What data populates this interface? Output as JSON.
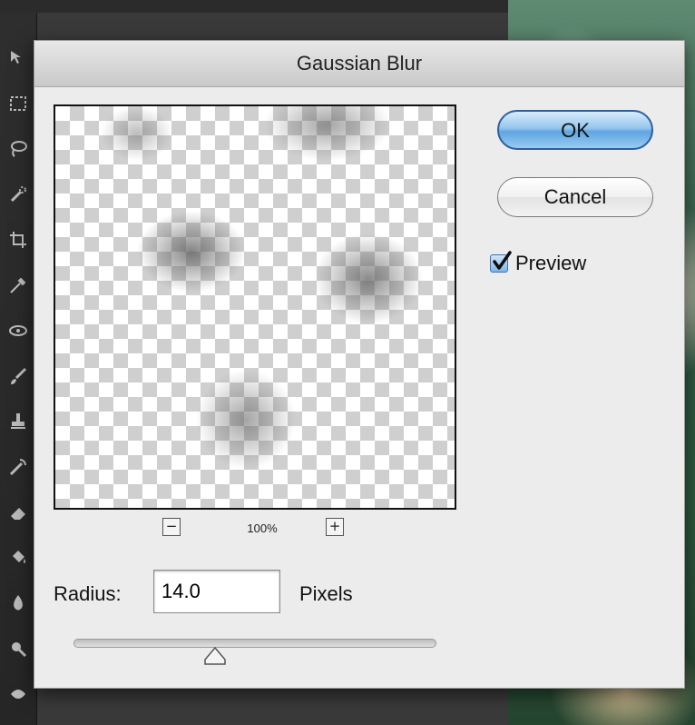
{
  "dialog": {
    "title": "Gaussian Blur",
    "ok_label": "OK",
    "cancel_label": "Cancel",
    "preview_label": "Preview",
    "preview_checked": true
  },
  "zoom": {
    "level": "100%",
    "minus_icon": "zoom-out-icon",
    "plus_icon": "zoom-in-icon",
    "minus_glyph": "−",
    "plus_glyph": "+"
  },
  "radius": {
    "label": "Radius:",
    "value": "14.0",
    "units": "Pixels",
    "slider_fraction": 0.39
  },
  "toolbox": {
    "icons": [
      "move-icon",
      "marquee-icon",
      "lasso-icon",
      "quick-selection-icon",
      "crop-icon",
      "eyedropper-icon",
      "spot-healing-icon",
      "brush-icon",
      "clone-stamp-icon",
      "history-brush-icon",
      "eraser-icon",
      "paint-bucket-icon",
      "blur-tool-icon",
      "dodge-icon"
    ]
  },
  "colors": {
    "ok_button_blue": "#5fa6e2",
    "dialog_bg": "#ececec",
    "checkbox_blue": "#3d6fb3"
  }
}
